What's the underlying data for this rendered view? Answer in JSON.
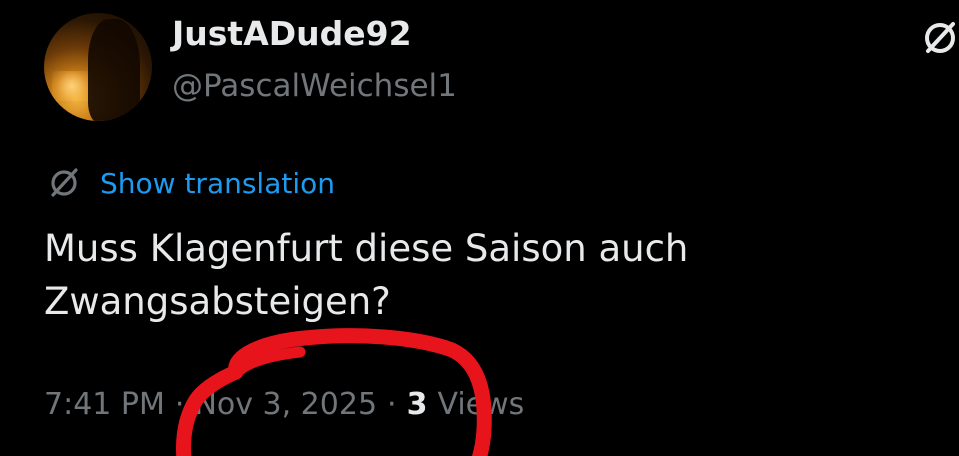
{
  "author": {
    "display_name": "JustADude92",
    "handle": "@PascalWeichsel1",
    "avatar_icon": "profile-photo"
  },
  "translate": {
    "icon": "translate-icon",
    "label": "Show translation"
  },
  "post": {
    "text": "Muss Klagenfurt diese Saison auch Zwangsabsteigen?"
  },
  "meta": {
    "time": "7:41 PM",
    "date": "Nov 3, 2025",
    "separator": "·",
    "views_count": "3",
    "views_label": "Views"
  },
  "colors": {
    "background": "#000000",
    "text_primary": "#e7e9ea",
    "text_secondary": "#71767b",
    "link": "#1d9bf0",
    "annotation": "#e8141c"
  }
}
